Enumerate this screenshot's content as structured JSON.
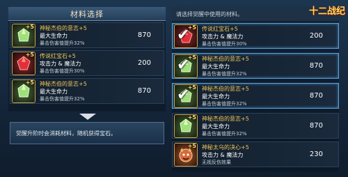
{
  "left_panel": {
    "title": "材料选择",
    "items": [
      {
        "name": "神秘杰伯的意志+5",
        "attr": "最大生命力",
        "bonus": "暴击伤害值提升32%",
        "value": "870",
        "plus": "+5",
        "icon": "green-crystal-icon"
      },
      {
        "name": "传说红宝石+5",
        "attr": "攻击力 & 魔法力",
        "bonus": "暴击伤害值提升30%",
        "value": "200",
        "plus": "+5",
        "icon": "red-ruby-icon"
      },
      {
        "name": "神秘杰伯的意志+5",
        "attr": "最大生命力",
        "bonus": "暴击伤害值提升32%",
        "value": "870",
        "plus": "+5",
        "icon": "green-crystal-icon"
      }
    ]
  },
  "note": {
    "text": "觉醒升阶时会消耗材料，随机获得宝石。"
  },
  "right_panel": {
    "header": "请选择觉醒中使用的材料。",
    "items": [
      {
        "name": "传说红宝石+5",
        "attr": "攻击力 & 魔法力",
        "bonus": "暴击伤害值提升30%",
        "value": "200",
        "plus": "+5",
        "checked": true,
        "icon": "red-ruby-icon"
      },
      {
        "name": "神秘杰伯的意志+5",
        "attr": "最大生命力",
        "bonus": "暴击伤害值提升32%",
        "value": "870",
        "plus": "+5",
        "checked": true,
        "icon": "green-crystal-icon"
      },
      {
        "name": "神秘杰伯的意志+5",
        "attr": "最大生命力",
        "bonus": "暴击伤害值提升32%",
        "value": "870",
        "plus": "+5",
        "checked": true,
        "icon": "green-crystal-icon"
      },
      {
        "name": "神秘杰伯的意志+5",
        "attr": "最大生命力",
        "bonus": "暴击伤害值提升32%",
        "value": "870",
        "plus": "+5",
        "checked": false,
        "icon": "green-crystal-icon"
      },
      {
        "name": "神秘太乌的决心+5",
        "attr": "攻击力 & 魔法力",
        "bonus": "无视反伤效果",
        "value": "230",
        "plus": "+5",
        "checked": false,
        "icon": "demon-mask-icon"
      }
    ]
  },
  "logo": {
    "text": "十二战纪"
  }
}
